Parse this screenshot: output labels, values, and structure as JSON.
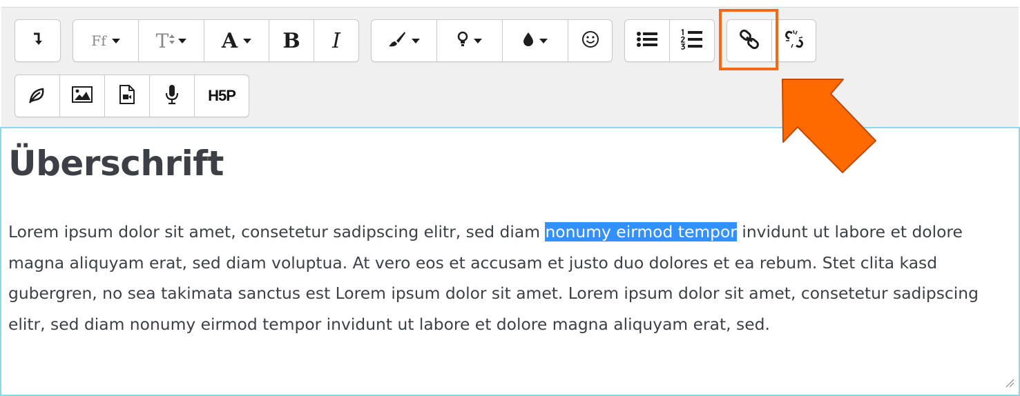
{
  "toolbar": {
    "row1": {
      "undo": {
        "icon": "indent-arrow-icon"
      },
      "font_family": {
        "label": "Ff"
      },
      "font_size": {
        "label": "T"
      },
      "font_color": {
        "label": "A"
      },
      "bold": {
        "label": "B"
      },
      "italic": {
        "label": "I"
      },
      "style": {
        "icon": "paintbrush-icon"
      },
      "hint": {
        "icon": "lightbulb-icon"
      },
      "background_color": {
        "icon": "drop-icon"
      },
      "emoji": {
        "icon": "smiley-icon"
      },
      "unordered_list": {
        "icon": "bullet-list-icon"
      },
      "ordered_list": {
        "icon": "numbered-list-icon"
      },
      "link": {
        "icon": "link-icon"
      },
      "unlink": {
        "icon": "unlink-icon"
      }
    },
    "row2": {
      "manage_files": {
        "icon": "leaf-icon"
      },
      "image": {
        "icon": "image-icon"
      },
      "video": {
        "icon": "video-file-icon"
      },
      "record_audio": {
        "icon": "microphone-icon"
      },
      "h5p": {
        "label": "H5P"
      }
    }
  },
  "content": {
    "heading": "Überschrift",
    "paragraph_before": "Lorem ipsum dolor sit amet, consetetur sadipscing elitr, sed diam ",
    "paragraph_selected": "nonumy eirmod tempor",
    "paragraph_after": " invidunt ut labore et dolore magna aliquyam erat, sed diam voluptua. At vero eos et accusam et justo duo dolores et ea rebum. Stet clita kasd gubergren, no sea takimata sanctus est Lorem ipsum dolor sit amet. Lorem ipsum dolor sit amet, consetetur sadipscing elitr, sed diam nonumy eirmod tempor invidunt ut labore et dolore magna aliquyam erat, sed."
  },
  "annotation": {
    "highlight_color": "#f26b14",
    "arrow_color": "#ff6a00",
    "target": "link-button"
  },
  "colors": {
    "toolbar_bg": "#f0f0f0",
    "editor_border": "#8fd8ec",
    "selection": "#3390ff",
    "text": "#3c3f45"
  }
}
